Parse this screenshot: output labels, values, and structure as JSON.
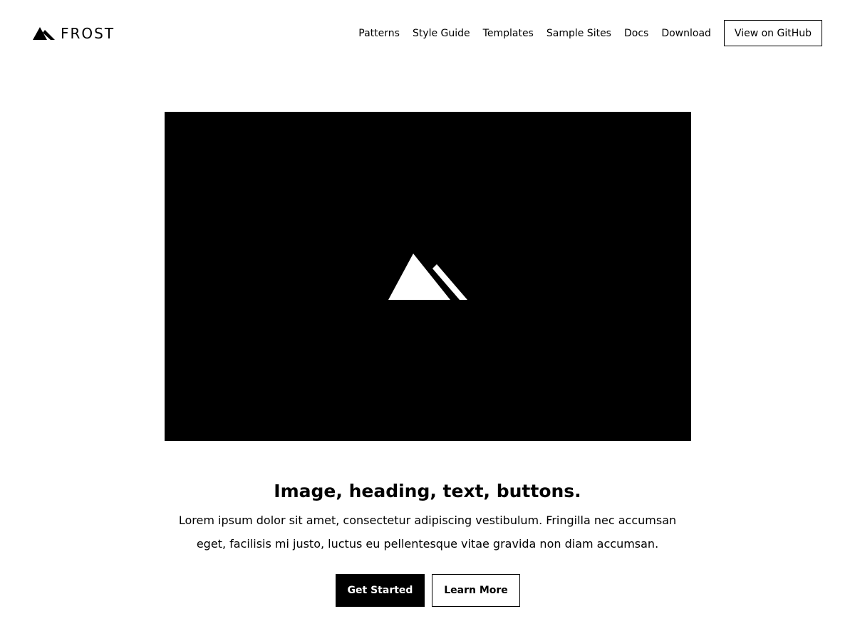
{
  "header": {
    "logo_text": "FROST",
    "logo_icon": "mountain-icon",
    "nav": [
      {
        "label": "Patterns"
      },
      {
        "label": "Style Guide"
      },
      {
        "label": "Templates"
      },
      {
        "label": "Sample Sites"
      },
      {
        "label": "Docs"
      },
      {
        "label": "Download"
      }
    ],
    "github_button": "View on GitHub"
  },
  "hero": {
    "image_icon": "mountain-icon",
    "image_background": "#000000",
    "heading": "Image, heading, text, buttons.",
    "body": "Lorem ipsum dolor sit amet, consectetur adipiscing vestibulum. Fringilla nec accumsan eget, facilisis mi justo, luctus eu pellentesque vitae gravida non diam accumsan.",
    "primary_button": "Get Started",
    "secondary_button": "Learn More"
  },
  "colors": {
    "background": "#ffffff",
    "text": "#000000",
    "primary_button_bg": "#000000",
    "primary_button_text": "#ffffff"
  }
}
